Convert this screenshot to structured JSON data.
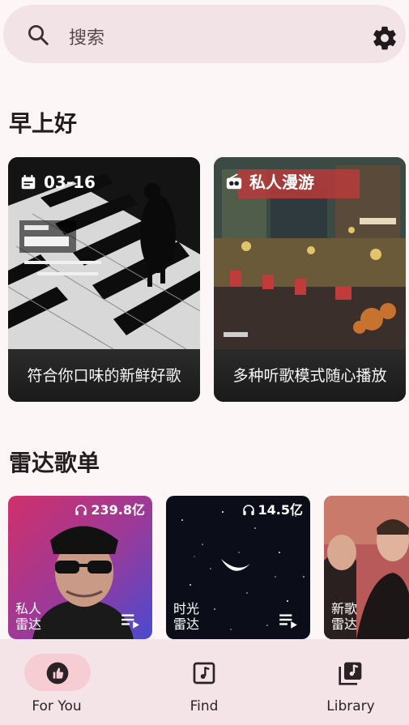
{
  "search": {
    "placeholder": "搜索"
  },
  "sections": {
    "morning_title": "早上好",
    "radar_title": "雷达歌单"
  },
  "cards": [
    {
      "badge": "03-16",
      "badge_icon": "calendar-icon",
      "caption": "符合你口味的新鲜好歌"
    },
    {
      "badge": "私人漫游",
      "badge_icon": "radio-icon",
      "caption": "多种听歌模式随心播放"
    }
  ],
  "playlists": [
    {
      "plays": "239.8亿",
      "line1": "私人",
      "line2": "雷达"
    },
    {
      "plays": "14.5亿",
      "line1": "时光",
      "line2": "雷达"
    },
    {
      "plays": "",
      "line1": "新歌",
      "line2": "雷达"
    }
  ],
  "nav": [
    {
      "label": "For You",
      "icon": "thumb-up-icon",
      "active": true
    },
    {
      "label": "Find",
      "icon": "music-note-icon",
      "active": false
    },
    {
      "label": "Library",
      "icon": "library-icon",
      "active": false
    }
  ],
  "colors": {
    "background": "#fdf6f6",
    "search_bar": "#f2e3e6",
    "nav_bar": "#f5e4e7",
    "nav_active_pill": "#f7cdd4"
  }
}
